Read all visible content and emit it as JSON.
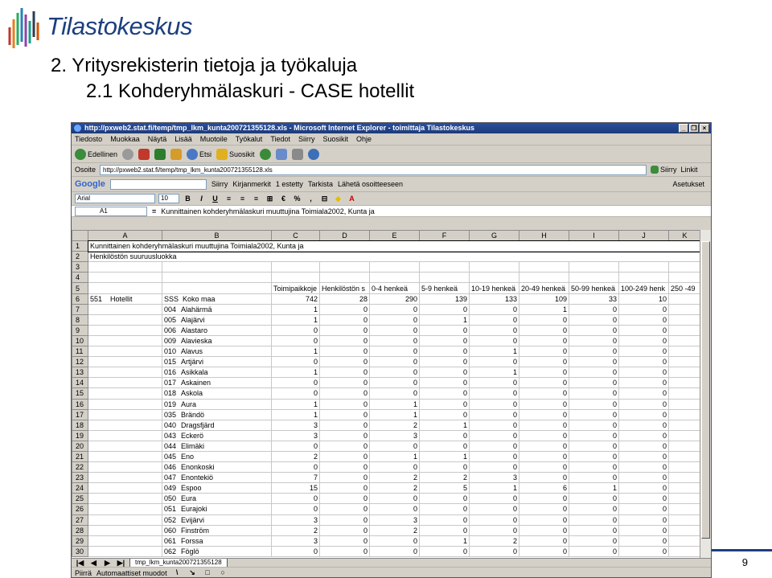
{
  "brand": {
    "name": "Tilastokeskus",
    "color": "#1c3f7e"
  },
  "slide": {
    "title_line1": "2. Yritysrekisterin tietoja ja työkaluja",
    "title_line2": "2.1 Kohderyhmälaskuri - CASE hotellit",
    "page_number": "9"
  },
  "window": {
    "title": "http://pxweb2.stat.fi/temp/tmp_lkm_kunta200721355128.xls - Microsoft Internet Explorer - toimittaja Tilastokeskus",
    "controls": [
      "_",
      "❐",
      "×"
    ],
    "menu": [
      "Tiedosto",
      "Muokkaa",
      "Näytä",
      "Lisää",
      "Muotoile",
      "Työkalut",
      "Tiedot",
      "Siirry",
      "Suosikit",
      "Ohje"
    ],
    "toolbar": {
      "back": "Edellinen",
      "search": "Etsi",
      "favorites": "Suosikit"
    },
    "address": {
      "label": "Osoite",
      "value": "http://pxweb2.stat.fi/temp/tmp_lkm_kunta200721355128.xls",
      "go": "Siirry",
      "links": "Linkit"
    },
    "google": {
      "logo": "Google",
      "go": "Siirry",
      "bookmarks": "Kirjanmerkit",
      "blocked": "1 estetty",
      "check": "Tarkista",
      "send": "Lähetä osoitteeseen",
      "settings": "Asetukset"
    }
  },
  "excel": {
    "font": "Arial",
    "size": "10",
    "name_box": "A1",
    "formula": "Kunnittainen kohderyhmälaskuri muuttujina Toimiala2002, Kunta ja",
    "columns": [
      "A",
      "B",
      "C",
      "D",
      "E",
      "F",
      "G",
      "H",
      "I",
      "J",
      "K"
    ],
    "row1": "Kunnittainen kohderyhmälaskuri muuttujina Toimiala2002, Kunta ja",
    "row2": "Henkilöstön suuruusluokka",
    "header_row": [
      "Toimipaikkoje",
      "Henkilöstön s",
      "0-4 henkeä",
      "5-9 henkeä",
      "10-19 henkeä",
      "20-49 henkeä",
      "50-99 henkeä",
      "100-249 henk",
      "250 -49"
    ],
    "row6": {
      "a1": "551",
      "a2": "Hotellit",
      "b1": "SSS",
      "b2": "Koko maa",
      "values": [
        "742",
        "28",
        "290",
        "139",
        "133",
        "109",
        "33",
        "10",
        ""
      ]
    },
    "rows": [
      {
        "n": "7",
        "code": "004",
        "name": "Alahärmä",
        "v": [
          "1",
          "0",
          "0",
          "0",
          "0",
          "1",
          "0",
          "0",
          ""
        ]
      },
      {
        "n": "8",
        "code": "005",
        "name": "Alajärvi",
        "v": [
          "1",
          "0",
          "0",
          "1",
          "0",
          "0",
          "0",
          "0",
          ""
        ]
      },
      {
        "n": "9",
        "code": "006",
        "name": "Alastaro",
        "v": [
          "0",
          "0",
          "0",
          "0",
          "0",
          "0",
          "0",
          "0",
          ""
        ]
      },
      {
        "n": "10",
        "code": "009",
        "name": "Alavieska",
        "v": [
          "0",
          "0",
          "0",
          "0",
          "0",
          "0",
          "0",
          "0",
          ""
        ]
      },
      {
        "n": "11",
        "code": "010",
        "name": "Alavus",
        "v": [
          "1",
          "0",
          "0",
          "0",
          "1",
          "0",
          "0",
          "0",
          ""
        ]
      },
      {
        "n": "12",
        "code": "015",
        "name": "Artjärvi",
        "v": [
          "0",
          "0",
          "0",
          "0",
          "0",
          "0",
          "0",
          "0",
          ""
        ]
      },
      {
        "n": "13",
        "code": "016",
        "name": "Asikkala",
        "v": [
          "1",
          "0",
          "0",
          "0",
          "1",
          "0",
          "0",
          "0",
          ""
        ]
      },
      {
        "n": "14",
        "code": "017",
        "name": "Askainen",
        "v": [
          "0",
          "0",
          "0",
          "0",
          "0",
          "0",
          "0",
          "0",
          ""
        ]
      },
      {
        "n": "15",
        "code": "018",
        "name": "Askola",
        "v": [
          "0",
          "0",
          "0",
          "0",
          "0",
          "0",
          "0",
          "0",
          ""
        ]
      },
      {
        "n": "16",
        "code": "019",
        "name": "Aura",
        "v": [
          "1",
          "0",
          "1",
          "0",
          "0",
          "0",
          "0",
          "0",
          ""
        ]
      },
      {
        "n": "17",
        "code": "035",
        "name": "Brändö",
        "v": [
          "1",
          "0",
          "1",
          "0",
          "0",
          "0",
          "0",
          "0",
          ""
        ]
      },
      {
        "n": "18",
        "code": "040",
        "name": "Dragsfjärd",
        "v": [
          "3",
          "0",
          "2",
          "1",
          "0",
          "0",
          "0",
          "0",
          ""
        ]
      },
      {
        "n": "19",
        "code": "043",
        "name": "Eckerö",
        "v": [
          "3",
          "0",
          "3",
          "0",
          "0",
          "0",
          "0",
          "0",
          ""
        ]
      },
      {
        "n": "20",
        "code": "044",
        "name": "Elimäki",
        "v": [
          "0",
          "0",
          "0",
          "0",
          "0",
          "0",
          "0",
          "0",
          ""
        ]
      },
      {
        "n": "21",
        "code": "045",
        "name": "Eno",
        "v": [
          "2",
          "0",
          "1",
          "1",
          "0",
          "0",
          "0",
          "0",
          ""
        ]
      },
      {
        "n": "22",
        "code": "046",
        "name": "Enonkoski",
        "v": [
          "0",
          "0",
          "0",
          "0",
          "0",
          "0",
          "0",
          "0",
          ""
        ]
      },
      {
        "n": "23",
        "code": "047",
        "name": "Enontekiö",
        "v": [
          "7",
          "0",
          "2",
          "2",
          "3",
          "0",
          "0",
          "0",
          ""
        ]
      },
      {
        "n": "24",
        "code": "049",
        "name": "Espoo",
        "v": [
          "15",
          "0",
          "2",
          "5",
          "1",
          "6",
          "1",
          "0",
          ""
        ]
      },
      {
        "n": "25",
        "code": "050",
        "name": "Eura",
        "v": [
          "0",
          "0",
          "0",
          "0",
          "0",
          "0",
          "0",
          "0",
          ""
        ]
      },
      {
        "n": "26",
        "code": "051",
        "name": "Eurajoki",
        "v": [
          "0",
          "0",
          "0",
          "0",
          "0",
          "0",
          "0",
          "0",
          ""
        ]
      },
      {
        "n": "27",
        "code": "052",
        "name": "Evijärvi",
        "v": [
          "3",
          "0",
          "3",
          "0",
          "0",
          "0",
          "0",
          "0",
          ""
        ]
      },
      {
        "n": "28",
        "code": "060",
        "name": "Finström",
        "v": [
          "2",
          "0",
          "2",
          "0",
          "0",
          "0",
          "0",
          "0",
          ""
        ]
      },
      {
        "n": "29",
        "code": "061",
        "name": "Forssa",
        "v": [
          "3",
          "0",
          "0",
          "1",
          "2",
          "0",
          "0",
          "0",
          ""
        ]
      },
      {
        "n": "30",
        "code": "062",
        "name": "Föglö",
        "v": [
          "0",
          "0",
          "0",
          "0",
          "0",
          "0",
          "0",
          "0",
          ""
        ]
      }
    ],
    "sheet_tab": "tmp_lkm_kunta200721355128",
    "draw_label": "Piirrä",
    "autoshapes": "Automaattiset muodot"
  }
}
